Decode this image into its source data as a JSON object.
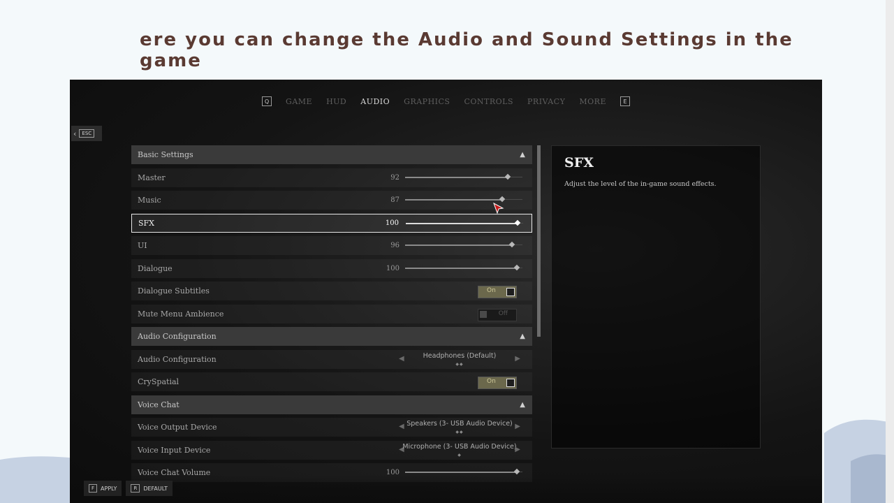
{
  "caption": "ere you can change the Audio and Sound Settings in the game",
  "topbar": {
    "left_key": "Q",
    "right_key": "E",
    "tabs": [
      {
        "label": "GAME",
        "active": false
      },
      {
        "label": "HUD",
        "active": false
      },
      {
        "label": "AUDIO",
        "active": true
      },
      {
        "label": "GRAPHICS",
        "active": false
      },
      {
        "label": "CONTROLS",
        "active": false
      },
      {
        "label": "PRIVACY",
        "active": false
      },
      {
        "label": "MORE",
        "active": false
      }
    ]
  },
  "back": {
    "key": "ESC"
  },
  "sections": {
    "basic": {
      "label": "Basic Settings"
    },
    "audio_config": {
      "label": "Audio Configuration"
    },
    "voice_chat": {
      "label": "Voice Chat"
    }
  },
  "settings": {
    "master": {
      "label": "Master",
      "value": "92",
      "level": 0.92
    },
    "music": {
      "label": "Music",
      "value": "87",
      "level": 0.87
    },
    "sfx": {
      "label": "SFX",
      "value": "100",
      "level": 1.0
    },
    "ui": {
      "label": "UI",
      "value": "96",
      "level": 0.96
    },
    "dialogue": {
      "label": "Dialogue",
      "value": "100",
      "level": 1.0
    },
    "dialogue_subtitles": {
      "label": "Dialogue Subtitles",
      "state": "On"
    },
    "mute_menu_ambience": {
      "label": "Mute Menu Ambience",
      "state": "Off"
    },
    "audio_configuration": {
      "label": "Audio Configuration",
      "selected": "Headphones (Default)"
    },
    "cryspatial": {
      "label": "CrySpatial",
      "state": "On"
    },
    "voice_output": {
      "label": "Voice Output Device",
      "selected": "Speakers (3- USB Audio Device)"
    },
    "voice_input": {
      "label": "Voice Input Device",
      "selected": "Microphone (3- USB Audio Device)"
    },
    "voice_chat_volume": {
      "label": "Voice Chat Volume",
      "value": "100",
      "level": 1.0
    }
  },
  "detail_panel": {
    "title": "SFX",
    "description": "Adjust the level of the in-game sound effects."
  },
  "bottombar": {
    "apply": {
      "key": "F",
      "label": "APPLY"
    },
    "default": {
      "key": "R",
      "label": "DEFAULT"
    }
  },
  "colors": {
    "caption": "#5a3a32",
    "background": "#f4f9fb",
    "toggle_on": "#6b684c"
  }
}
